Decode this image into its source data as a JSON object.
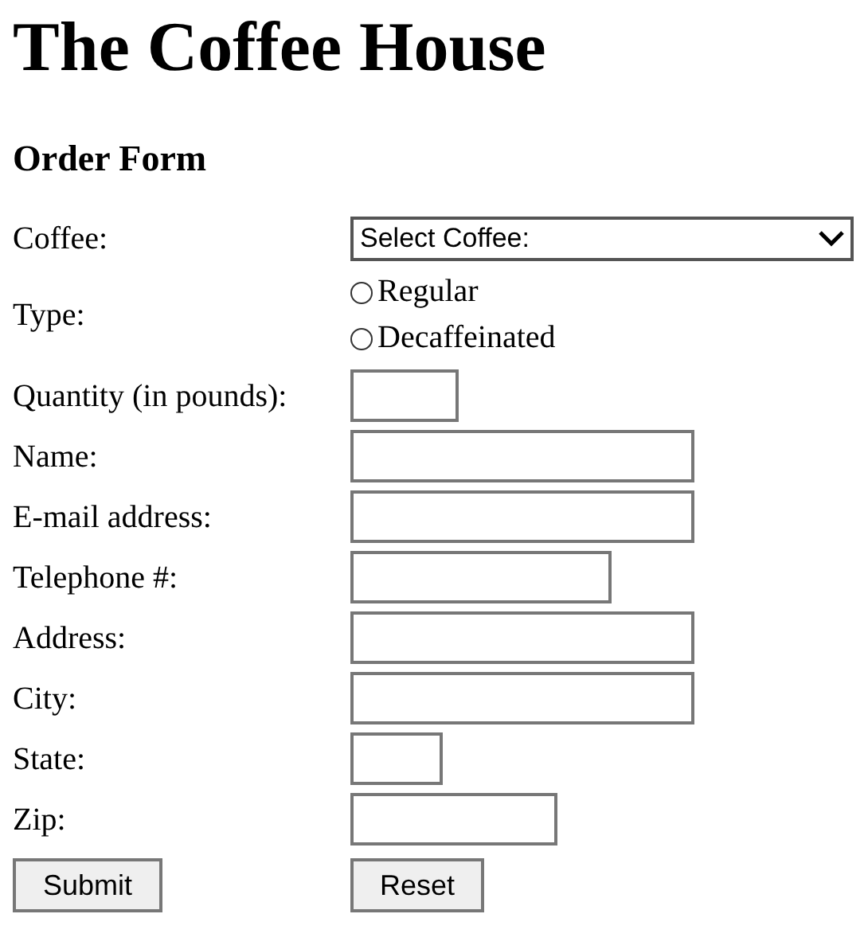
{
  "title": "The Coffee House",
  "subtitle": "Order Form",
  "fields": [
    {
      "kind": "select",
      "label": "Coffee:",
      "value": "Select Coffee:"
    },
    {
      "kind": "radio",
      "label": "Type:",
      "options": [
        {
          "label": "Regular",
          "selected": false
        },
        {
          "label": "Decaffeinated",
          "selected": false
        }
      ]
    },
    {
      "kind": "text",
      "label": "Quantity (in pounds):"
    },
    {
      "kind": "text",
      "label": "Name:"
    },
    {
      "kind": "text",
      "label": "E-mail address:"
    },
    {
      "kind": "text",
      "label": "Telephone #:"
    },
    {
      "kind": "text",
      "label": "Address:"
    },
    {
      "kind": "text",
      "label": "City:"
    },
    {
      "kind": "text",
      "label": "State:"
    },
    {
      "kind": "text",
      "label": "Zip:"
    }
  ],
  "buttons": [
    "Submit",
    "Reset"
  ]
}
